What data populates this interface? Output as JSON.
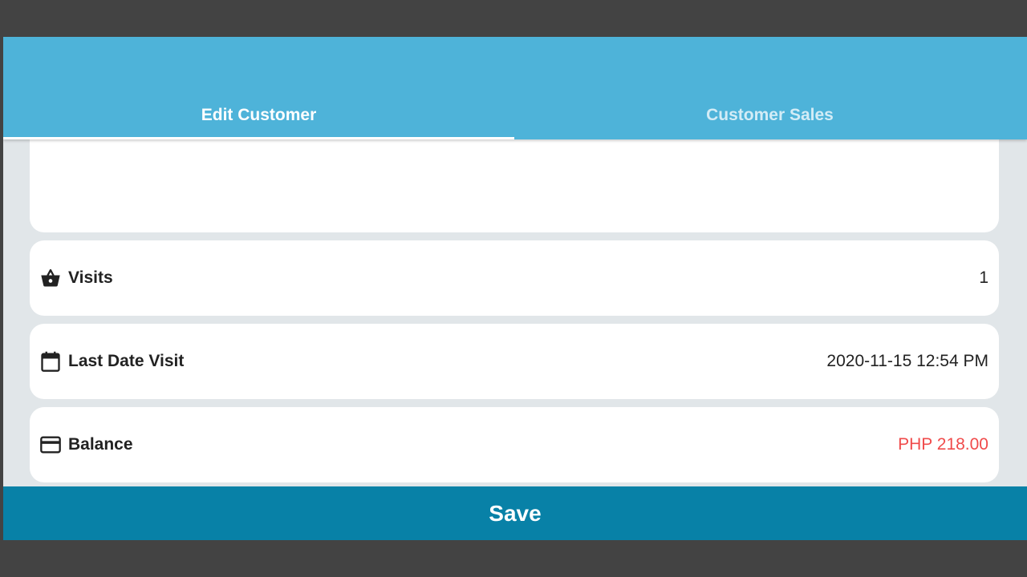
{
  "tabs": {
    "edit_customer": "Edit Customer",
    "customer_sales": "Customer Sales",
    "active": "Edit Customer"
  },
  "rows": {
    "visits": {
      "label": "Visits",
      "value": "1",
      "icon": "basket-icon"
    },
    "last_date_visit": {
      "label": "Last Date Visit",
      "value": "2020-11-15 12:54 PM",
      "icon": "calendar-icon"
    },
    "balance": {
      "label": "Balance",
      "value": "PHP 218.00",
      "icon": "credit-card-icon"
    }
  },
  "save_label": "Save",
  "colors": {
    "app_bar": "#4eb3d9",
    "save_button": "#0881a7",
    "balance_value": "#f04b4b",
    "background": "#e1e6e9"
  }
}
